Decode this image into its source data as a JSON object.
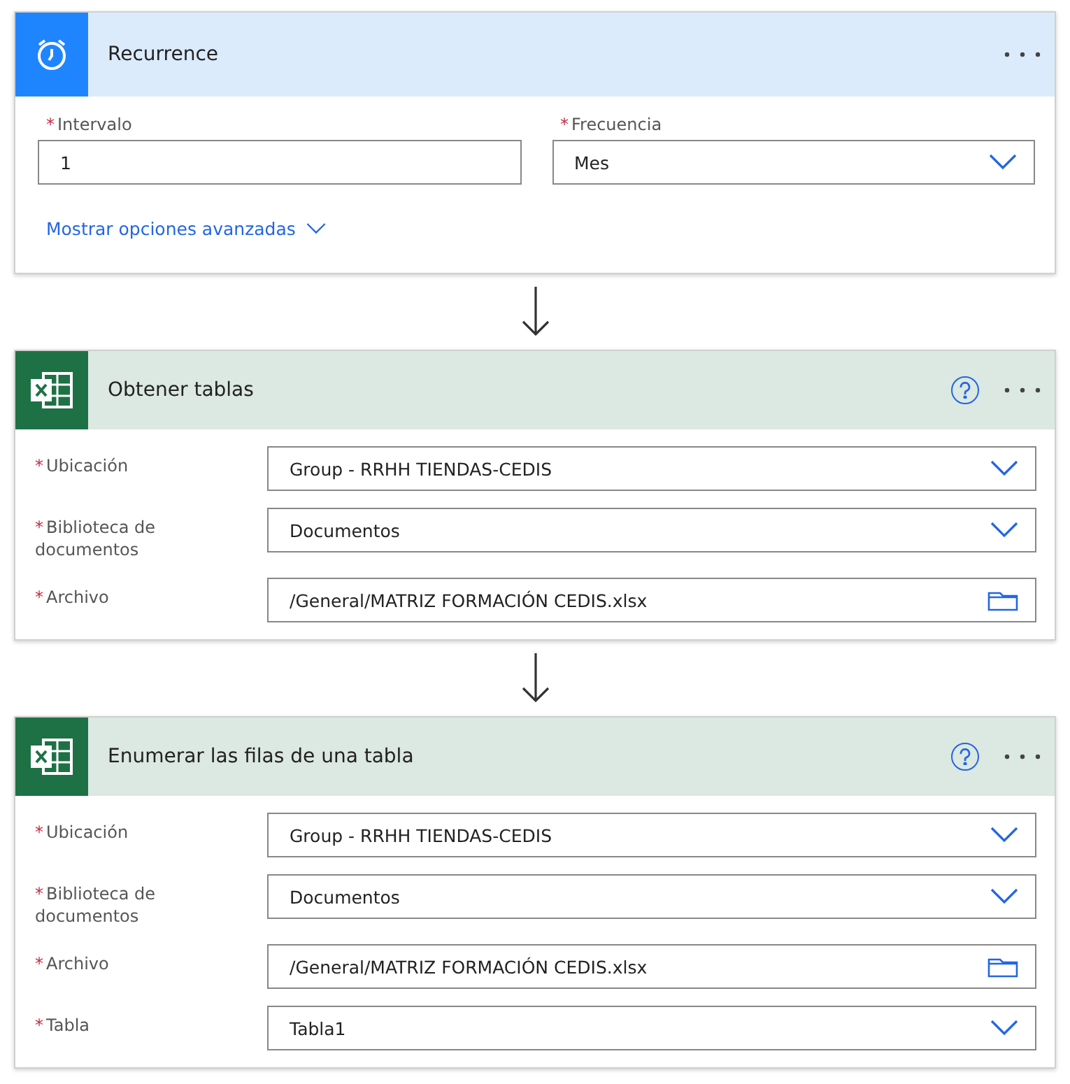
{
  "cards": [
    {
      "kind": "trigger",
      "title": "Recurrence",
      "help": false,
      "fields": [
        {
          "label": "Intervalo",
          "required_mark": "*",
          "kind": "text",
          "value": "1"
        },
        {
          "label": "Frecuencia",
          "required_mark": "*",
          "kind": "dropdown",
          "value": "Mes"
        }
      ],
      "advanced_link": "Mostrar opciones avanzadas"
    },
    {
      "kind": "action",
      "title": "Obtener tablas",
      "help": true,
      "fields": [
        {
          "label": "Ubicación",
          "required_mark": "*",
          "kind": "dropdown",
          "value": "Group - RRHH TIENDAS-CEDIS"
        },
        {
          "label": "Biblioteca de documentos",
          "required_mark": "*",
          "kind": "dropdown",
          "value": "Documentos"
        },
        {
          "label": "Archivo",
          "required_mark": "*",
          "kind": "file",
          "value": "/General/MATRIZ FORMACIÓN CEDIS.xlsx"
        }
      ]
    },
    {
      "kind": "action",
      "title": "Enumerar las filas de una tabla",
      "help": true,
      "fields": [
        {
          "label": "Ubicación",
          "required_mark": "*",
          "kind": "dropdown",
          "value": "Group - RRHH TIENDAS-CEDIS"
        },
        {
          "label": "Biblioteca de documentos",
          "required_mark": "*",
          "kind": "dropdown",
          "value": "Documentos"
        },
        {
          "label": "Archivo",
          "required_mark": "*",
          "kind": "file",
          "value": "/General/MATRIZ FORMACIÓN CEDIS.xlsx"
        },
        {
          "label": "Tabla",
          "required_mark": "*",
          "kind": "dropdown",
          "value": "Tabla1"
        }
      ]
    }
  ]
}
